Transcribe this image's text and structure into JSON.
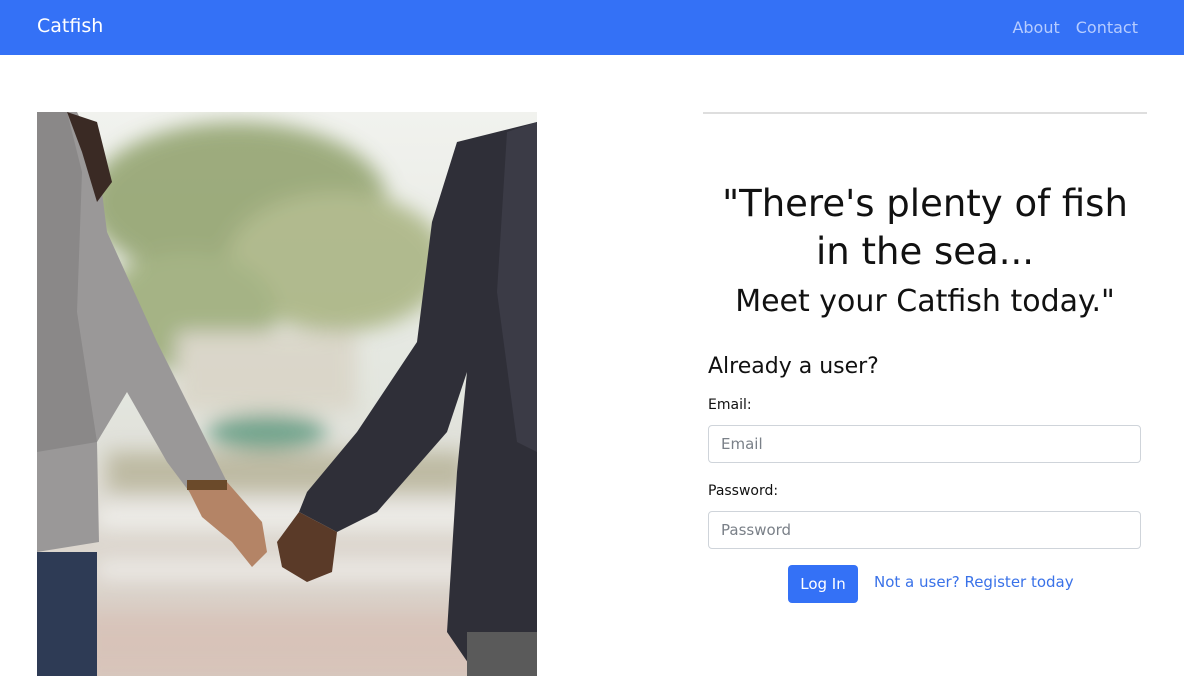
{
  "navbar": {
    "brand": "Catfish",
    "links": [
      {
        "label": "About"
      },
      {
        "label": "Contact"
      }
    ],
    "background_color": "#3471f6"
  },
  "hero_image": {
    "description_icon": "couple-holding-hands-photo"
  },
  "tagline": {
    "line1": "\"There's plenty of fish in the sea...",
    "line2": "Meet your Catfish today.\""
  },
  "login": {
    "heading": "Already a user?",
    "email": {
      "label": "Email:",
      "placeholder": "Email",
      "value": ""
    },
    "password": {
      "label": "Password:",
      "placeholder": "Password",
      "value": ""
    },
    "submit_label": "Log In",
    "register_link": "Not a user? Register today"
  },
  "colors": {
    "accent": "#3471f6",
    "link": "#3a72e8"
  }
}
